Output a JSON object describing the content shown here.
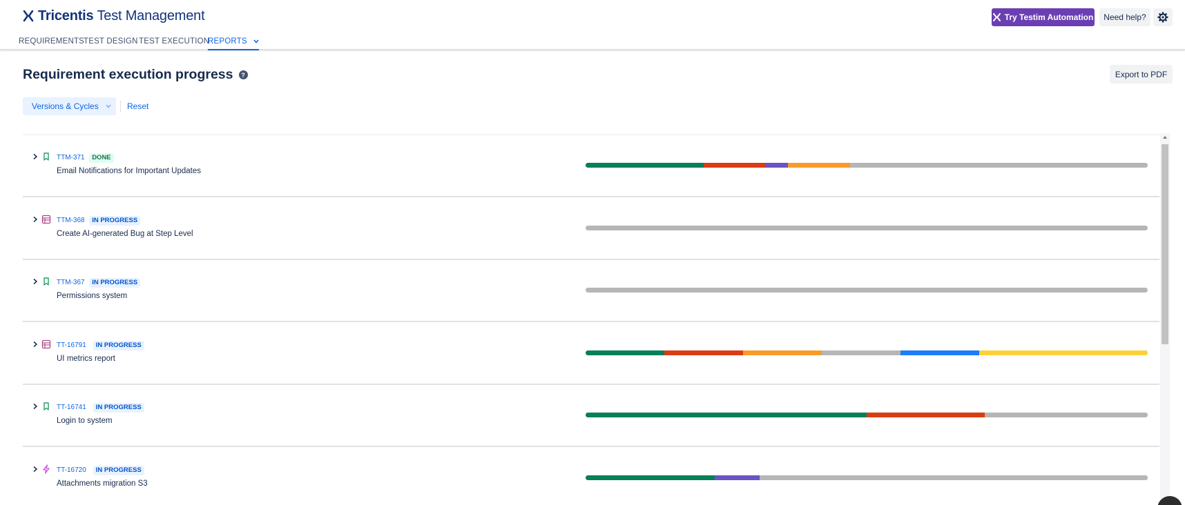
{
  "app": {
    "logo_brand": "Tricentis",
    "logo_product": "Test Management"
  },
  "header": {
    "testim_label": "Try Testim Automation",
    "help_label": "Need help?"
  },
  "nav": {
    "items": [
      {
        "label": "REQUIREMENTS"
      },
      {
        "label": "TEST DESIGN"
      },
      {
        "label": "TEST EXECUTION"
      },
      {
        "label": "REPORTS"
      }
    ],
    "active": "REPORTS"
  },
  "page": {
    "title": "Requirement execution progress",
    "export_label": "Export to PDF",
    "filter_label": "Versions & Cycles",
    "reset_label": "Reset"
  },
  "colors": {
    "passed": "#067f5a",
    "failed": "#d93d12",
    "blocked": "#6a54c4",
    "in_progress": "#f99b2a",
    "not_executed": "#b6b6b6",
    "custom_blue": "#1c7cf9",
    "custom_yellow": "#fdd13a"
  },
  "requirements": [
    {
      "key": "TTM-371",
      "status": "DONE",
      "status_type": "done",
      "type": "story",
      "summary": "Email Notifications for Important Updates",
      "progress": [
        {
          "status": "passed",
          "fraction": 0.21
        },
        {
          "status": "failed",
          "fraction": 0.11
        },
        {
          "status": "blocked",
          "fraction": 0.04
        },
        {
          "status": "in_progress",
          "fraction": 0.11
        },
        {
          "status": "not_executed",
          "fraction": 0.53
        }
      ]
    },
    {
      "key": "TTM-368",
      "status": "IN PROGRESS",
      "status_type": "progress",
      "type": "epic",
      "summary": "Create AI-generated Bug at Step Level",
      "progress": [
        {
          "status": "not_executed",
          "fraction": 1.0
        }
      ]
    },
    {
      "key": "TTM-367",
      "status": "IN PROGRESS",
      "status_type": "progress",
      "type": "story",
      "summary": "Permissions system",
      "progress": [
        {
          "status": "not_executed",
          "fraction": 1.0
        }
      ]
    },
    {
      "key": "TT-16791",
      "status": "IN PROGRESS",
      "status_type": "progress",
      "type": "epic",
      "summary": "UI metrics report",
      "progress": [
        {
          "status": "passed",
          "fraction": 0.14
        },
        {
          "status": "failed",
          "fraction": 0.14
        },
        {
          "status": "in_progress",
          "fraction": 0.14
        },
        {
          "status": "not_executed",
          "fraction": 0.14
        },
        {
          "status": "custom_blue",
          "fraction": 0.14
        },
        {
          "status": "custom_yellow",
          "fraction": 0.3
        }
      ]
    },
    {
      "key": "TT-16741",
      "status": "IN PROGRESS",
      "status_type": "progress",
      "type": "story",
      "summary": "Login to system",
      "progress": [
        {
          "status": "passed",
          "fraction": 0.5
        },
        {
          "status": "failed",
          "fraction": 0.21
        },
        {
          "status": "not_executed",
          "fraction": 0.29
        }
      ]
    },
    {
      "key": "TT-16720",
      "status": "IN PROGRESS",
      "status_type": "progress",
      "type": "spike",
      "summary": "Attachments migration S3",
      "progress": [
        {
          "status": "passed",
          "fraction": 0.23
        },
        {
          "status": "blocked",
          "fraction": 0.08
        },
        {
          "status": "not_executed",
          "fraction": 0.69
        }
      ]
    }
  ]
}
